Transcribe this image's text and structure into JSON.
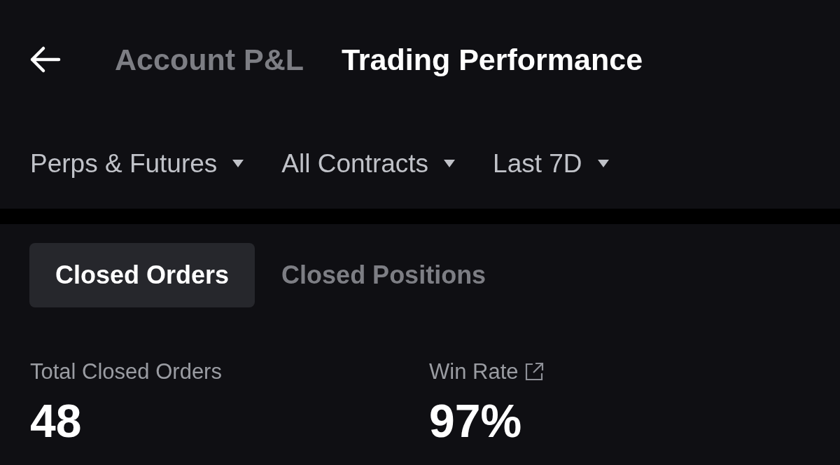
{
  "header_tabs": [
    {
      "label": "Account P&L",
      "selected": false
    },
    {
      "label": "Trading Performance",
      "selected": true
    }
  ],
  "filters": [
    {
      "label": "Perps & Futures"
    },
    {
      "label": "All Contracts"
    },
    {
      "label": "Last 7D"
    }
  ],
  "segments": [
    {
      "label": "Closed Orders",
      "selected": true
    },
    {
      "label": "Closed Positions",
      "selected": false
    }
  ],
  "stats": [
    {
      "label": "Total Closed Orders",
      "value": "48",
      "link": false
    },
    {
      "label": "Win Rate",
      "value": "97%",
      "link": true
    }
  ]
}
